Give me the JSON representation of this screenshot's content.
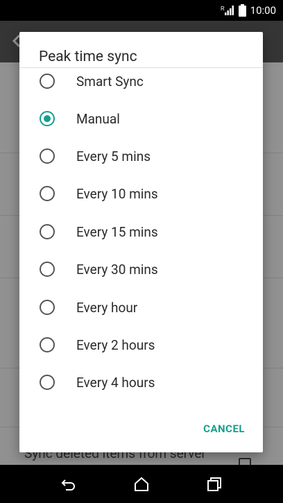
{
  "status_bar": {
    "time": "10:00",
    "icons": [
      "signal-icon",
      "battery-icon"
    ]
  },
  "background": {
    "sync_deleted_label": "Sync deleted items from server"
  },
  "dialog": {
    "title": "Peak time sync",
    "options": [
      {
        "label": "Smart Sync",
        "checked": false
      },
      {
        "label": "Manual",
        "checked": true
      },
      {
        "label": "Every 5 mins",
        "checked": false
      },
      {
        "label": "Every 10 mins",
        "checked": false
      },
      {
        "label": "Every 15 mins",
        "checked": false
      },
      {
        "label": "Every 30 mins",
        "checked": false
      },
      {
        "label": "Every hour",
        "checked": false
      },
      {
        "label": "Every 2 hours",
        "checked": false
      },
      {
        "label": "Every 4 hours",
        "checked": false
      }
    ],
    "cancel_label": "CANCEL",
    "accent_color": "#169e8c"
  },
  "nav_bar": {
    "icons": [
      "back-icon",
      "home-icon",
      "recents-icon"
    ]
  }
}
